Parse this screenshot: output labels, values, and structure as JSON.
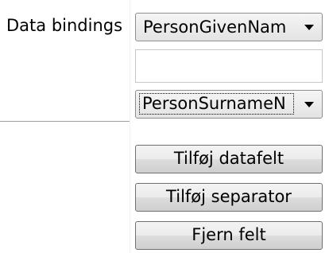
{
  "panel": {
    "label": "Data bindings",
    "given_name_combo": {
      "value": "PersonGivenNam",
      "arrow_icon": "dropdown-arrow-icon"
    },
    "separator_textbox": {
      "value": ""
    },
    "surname_combo": {
      "value": "PersonSurnameN",
      "arrow_icon": "dropdown-arrow-icon"
    },
    "buttons": {
      "add_field": "Tilføj datafelt",
      "add_separator": "Tilføj separator",
      "remove_field": "Fjern felt"
    }
  }
}
